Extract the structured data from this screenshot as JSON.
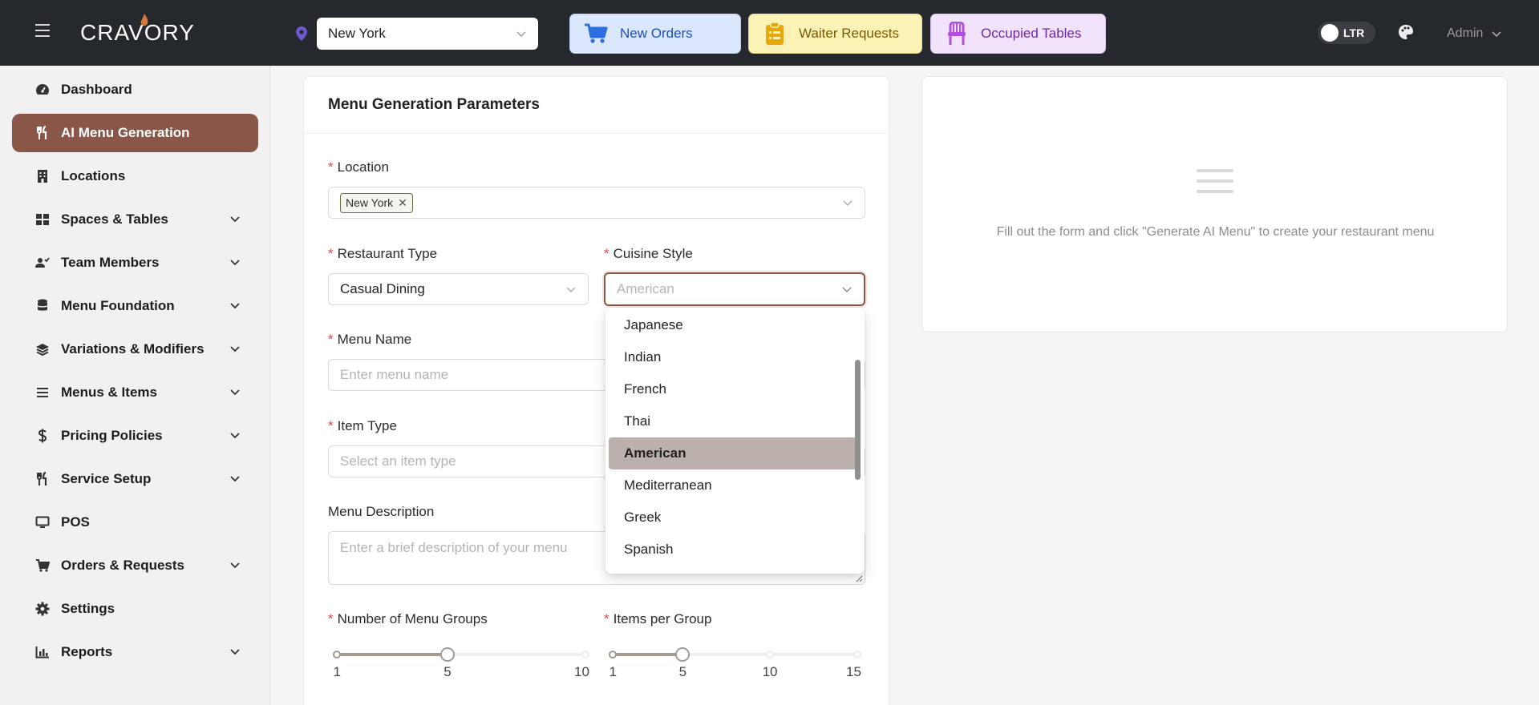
{
  "header": {
    "brand": "CRAVORY",
    "location_value": "New York",
    "quick_actions": [
      {
        "label": "New Orders",
        "icon": "cart-icon",
        "color": "#1e4fb8"
      },
      {
        "label": "Waiter Requests",
        "icon": "clipboard-icon",
        "color": "#7a5a08"
      },
      {
        "label": "Occupied Tables",
        "icon": "chair-icon",
        "color": "#6b2aa3"
      }
    ],
    "direction_toggle": "LTR",
    "user": "Admin"
  },
  "sidebar": {
    "active_color": "#8a5647",
    "items": [
      {
        "label": "Dashboard",
        "icon": "dashboard-gauge-icon",
        "has_children": false
      },
      {
        "label": "AI Menu Generation",
        "icon": "fork-knife-icon",
        "has_children": false,
        "active": true
      },
      {
        "label": "Locations",
        "icon": "building-icon",
        "has_children": false
      },
      {
        "label": "Spaces & Tables",
        "icon": "grid-icon",
        "has_children": true
      },
      {
        "label": "Team Members",
        "icon": "users-icon",
        "has_children": true
      },
      {
        "label": "Menu Foundation",
        "icon": "database-icon",
        "has_children": true
      },
      {
        "label": "Variations & Modifiers",
        "icon": "layers-icon",
        "has_children": true
      },
      {
        "label": "Menus & Items",
        "icon": "list-icon",
        "has_children": true
      },
      {
        "label": "Pricing Policies",
        "icon": "dollar-icon",
        "has_children": true
      },
      {
        "label": "Service Setup",
        "icon": "fork-knife-icon",
        "has_children": true
      },
      {
        "label": "POS",
        "icon": "monitor-icon",
        "has_children": false
      },
      {
        "label": "Orders & Requests",
        "icon": "cart-icon",
        "has_children": true
      },
      {
        "label": "Settings",
        "icon": "gear-icon",
        "has_children": false
      },
      {
        "label": "Reports",
        "icon": "bar-chart-icon",
        "has_children": true
      }
    ]
  },
  "form": {
    "title": "Menu Generation Parameters",
    "location": {
      "label": "Location",
      "tags": [
        "New York"
      ]
    },
    "restaurant_type": {
      "label": "Restaurant Type",
      "value": "Casual Dining"
    },
    "cuisine_style": {
      "label": "Cuisine Style",
      "placeholder": "American"
    },
    "menu_name": {
      "label": "Menu Name",
      "placeholder": "Enter menu name"
    },
    "item_type": {
      "label": "Item Type",
      "placeholder": "Select an item type"
    },
    "menu_description": {
      "label": "Menu Description",
      "placeholder": "Enter a brief description of your menu"
    },
    "menu_groups": {
      "label": "Number of Menu Groups",
      "min": 1,
      "max": 10,
      "value": 5,
      "marks": [
        "1",
        "5",
        "10"
      ]
    },
    "items_per_group": {
      "label": "Items per Group",
      "min": 1,
      "max": 15,
      "value": 5,
      "marks": [
        "1",
        "5",
        "10",
        "15"
      ]
    }
  },
  "cuisine_dropdown": {
    "options": [
      "Japanese",
      "Indian",
      "French",
      "Thai",
      "American",
      "Mediterranean",
      "Greek",
      "Spanish"
    ],
    "selected": "American"
  },
  "preview": {
    "empty_text": "Fill out the form and click \"Generate AI Menu\" to create your restaurant menu"
  }
}
